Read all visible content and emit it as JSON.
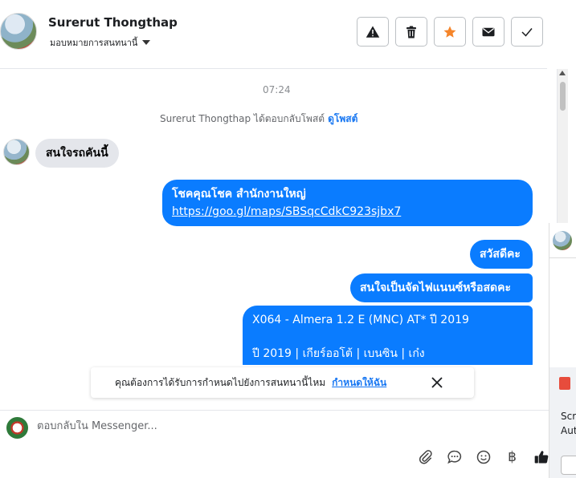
{
  "header": {
    "contact_name": "Surerut Thongthap",
    "assign_label": "มอบหมายการสนทนานี้",
    "actions": [
      {
        "name": "report-button",
        "icon": "warning-icon"
      },
      {
        "name": "delete-button",
        "icon": "trash-icon"
      },
      {
        "name": "star-button",
        "icon": "star-icon",
        "color": "#f5852a"
      },
      {
        "name": "mark-unread-button",
        "icon": "envelope-icon"
      },
      {
        "name": "mark-done-button",
        "icon": "checkmark-icon"
      }
    ]
  },
  "conversation": {
    "timestamp": "07:24",
    "system_message": "Surerut Thongthap ได้ตอบกลับโพสต์",
    "system_link": "ดูโพสต์",
    "incoming": [
      {
        "text": "สนใจรถคันนี้"
      }
    ],
    "outgoing": [
      {
        "line1": "โชคคุณโชค สำนักงานใหญ่",
        "link": "https://goo.gl/maps/SBSqcCdkC923sjbx7"
      },
      {
        "text": "สวัสดีคะ"
      },
      {
        "text": "สนใจเป็นจัดไฟแนนซ์หรือสดคะ"
      },
      {
        "line1": "X064 - Almera 1.2 E (MNC) AT* ปี 2019",
        "line2": "ปี 2019 |  เกียร์ออโต้ |  เบนซิน | เก๋ง"
      }
    ],
    "bubble_color": "#0a7cff"
  },
  "suggestion": {
    "text": "คุณต้องการได้รับการกำหนดไปยังการสนทนานี้ไหม",
    "link": "กำหนดให้ฉัน"
  },
  "composer": {
    "placeholder": "ตอบกลับใน Messenger...",
    "tools": [
      "attachment-icon",
      "saved-reply-icon",
      "emoji-icon",
      "baht-icon",
      "thumbs-up-icon"
    ],
    "baht_symbol": "฿"
  },
  "side_panel": {
    "text1": "Scr",
    "text2": "Aut"
  }
}
